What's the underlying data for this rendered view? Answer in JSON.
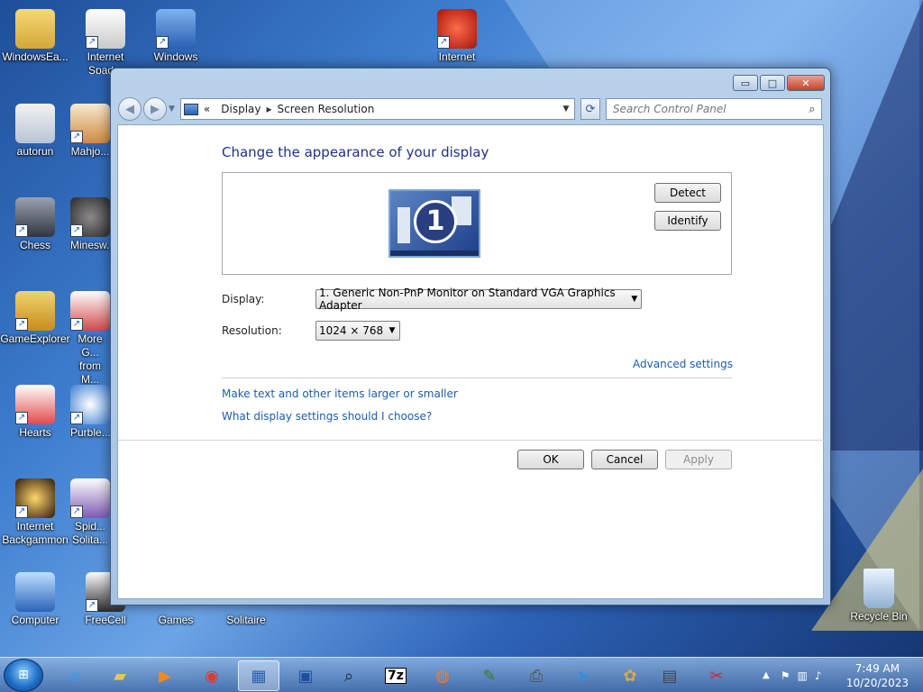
{
  "desktop_icons": [
    {
      "id": "windowseasy",
      "label": "WindowsEa...",
      "shortcut": false
    },
    {
      "id": "internet-spades",
      "label": "Internet Spad...",
      "shortcut": true
    },
    {
      "id": "windows",
      "label": "Windows",
      "shortcut": true
    },
    {
      "id": "internet",
      "label": "Internet",
      "shortcut": true
    },
    {
      "id": "autorun",
      "label": "autorun",
      "shortcut": false
    },
    {
      "id": "mahjong",
      "label": "Mahjo...",
      "shortcut": true
    },
    {
      "id": "chess",
      "label": "Chess",
      "shortcut": true
    },
    {
      "id": "minesweeper",
      "label": "Minesw...",
      "shortcut": true
    },
    {
      "id": "gameexplorer",
      "label": "GameExplorer",
      "shortcut": true
    },
    {
      "id": "more-games",
      "label": "More G... from M...",
      "shortcut": true
    },
    {
      "id": "hearts",
      "label": "Hearts",
      "shortcut": true
    },
    {
      "id": "purble",
      "label": "Purble...",
      "shortcut": true
    },
    {
      "id": "internet-backgammon",
      "label": "Internet Backgammon",
      "shortcut": true
    },
    {
      "id": "spider",
      "label": "Spid... Solita...",
      "shortcut": true
    },
    {
      "id": "computer",
      "label": "Computer",
      "shortcut": false
    },
    {
      "id": "freecell",
      "label": "FreeCell",
      "shortcut": true
    },
    {
      "id": "games",
      "label": "Games",
      "shortcut": false
    },
    {
      "id": "solitaire",
      "label": "Solitaire",
      "shortcut": false
    },
    {
      "id": "recycle-bin",
      "label": "Recycle Bin",
      "shortcut": false
    }
  ],
  "window": {
    "controls": {
      "minimize": "▭",
      "maximize": "□",
      "close": "✕"
    },
    "breadcrumb": {
      "prefix": "«",
      "items": [
        "Display",
        "Screen Resolution"
      ],
      "separator": "▸"
    },
    "search": {
      "placeholder": "Search Control Panel"
    },
    "title": "Change the appearance of your display",
    "monitor_number": "1",
    "detect_label": "Detect",
    "identify_label": "Identify",
    "display_label": "Display:",
    "display_value": "1. Generic Non-PnP Monitor on Standard VGA Graphics Adapter",
    "resolution_label": "Resolution:",
    "resolution_value": "1024 × 768",
    "advanced_link": "Advanced settings",
    "link_text_size": "Make text and other items larger or smaller",
    "link_display_help": "What display settings should I choose?",
    "ok_label": "OK",
    "cancel_label": "Cancel",
    "apply_label": "Apply"
  },
  "taskbar": {
    "start_glyph": "⊞",
    "clock_time": "7:49 AM",
    "clock_date": "10/20/2023"
  },
  "colors": {
    "title_blue": "#1e3287",
    "link_blue": "#1a5cb0",
    "close_red": "#c7412a"
  }
}
